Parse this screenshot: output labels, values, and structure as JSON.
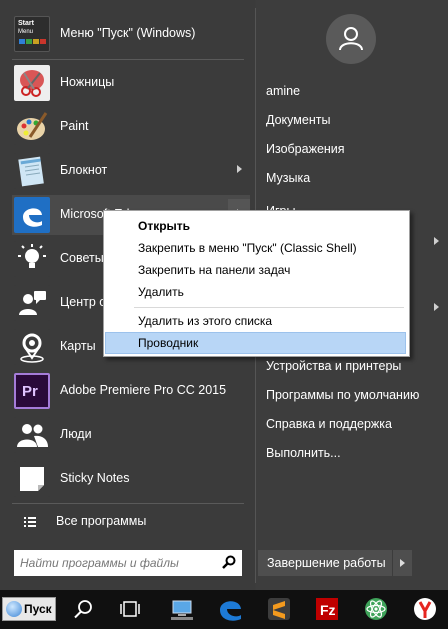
{
  "pinned": [
    {
      "label": "Меню \"Пуск\" (Windows)",
      "icon": "start-menu-icon",
      "arrow": false
    },
    {
      "label": "Ножницы",
      "icon": "scissors-icon",
      "arrow": false
    },
    {
      "label": "Paint",
      "icon": "paint-palette-icon",
      "arrow": false
    },
    {
      "label": "Блокнот",
      "icon": "notepad-icon",
      "arrow": true
    },
    {
      "label": "Microsoft Edge",
      "icon": "edge-icon",
      "arrow": true
    },
    {
      "label": "Советы",
      "icon": "lightbulb-icon",
      "arrow": false
    },
    {
      "label": "Центр отзывов",
      "icon": "feedback-icon",
      "arrow": false
    },
    {
      "label": "Карты",
      "icon": "maps-icon",
      "arrow": false
    },
    {
      "label": "Adobe Premiere Pro CC 2015",
      "icon": "premiere-icon",
      "arrow": false
    },
    {
      "label": "Люди",
      "icon": "people-icon",
      "arrow": false
    },
    {
      "label": "Sticky Notes",
      "icon": "sticky-notes-icon",
      "arrow": false
    }
  ],
  "start_tile_text": [
    "Start",
    "Menu"
  ],
  "all_programs": "Все программы",
  "search": {
    "placeholder": "Найти программы и файлы"
  },
  "right": {
    "user": "amine",
    "documents": "Документы",
    "pictures": "Изображения",
    "music": "Музыка",
    "games": "Игры",
    "devices": "Устройства и принтеры",
    "default_programs": "Программы по умолчанию",
    "help": "Справка и поддержка",
    "run": "Выполнить..."
  },
  "shutdown": "Завершение работы",
  "context_menu": {
    "open": "Открыть",
    "pin_start": "Закрепить в меню \"Пуск\" (Classic Shell)",
    "pin_taskbar": "Закрепить на панели задач",
    "delete": "Удалить",
    "remove_list": "Удалить из этого списка",
    "explorer": "Проводник"
  },
  "taskbar": {
    "start_label": "Пуск"
  }
}
